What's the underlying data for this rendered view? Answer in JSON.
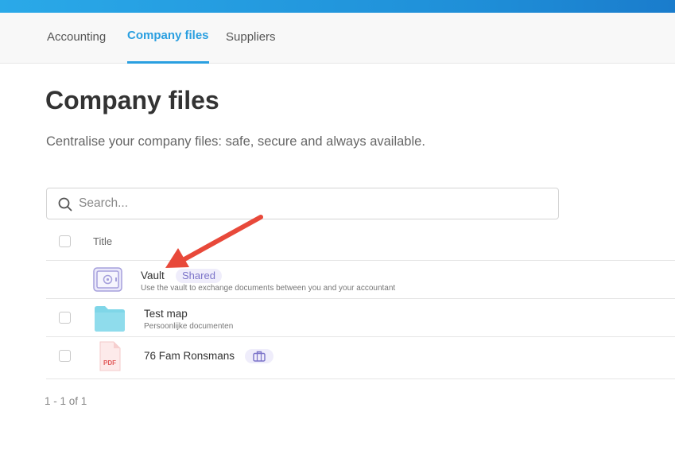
{
  "tabs": [
    {
      "label": "Accounting"
    },
    {
      "label": "Company files",
      "active": true
    },
    {
      "label": "Suppliers"
    }
  ],
  "page": {
    "title": "Company files",
    "description": "Centralise your company files: safe, secure and always available."
  },
  "search": {
    "placeholder": "Search..."
  },
  "table": {
    "header_title": "Title",
    "rows": [
      {
        "title": "Vault",
        "badge": "Shared",
        "subtitle": "Use the vault to exchange documents between you and your accountant",
        "icon": "vault-icon"
      },
      {
        "title": "Test map",
        "subtitle": "Persoonlijke documenten",
        "icon": "folder-icon"
      },
      {
        "title": "76 Fam Ronsmans",
        "icon": "pdf-icon",
        "file_label": "PDF",
        "badge_icon": "briefcase-icon"
      }
    ]
  },
  "pagination": "1 - 1 of 1",
  "colors": {
    "accent": "#2a9fe0",
    "badge_bg": "#efedfb",
    "badge_text": "#7b73c9",
    "arrow": "#e8493a",
    "folder": "#7fd6e8"
  }
}
